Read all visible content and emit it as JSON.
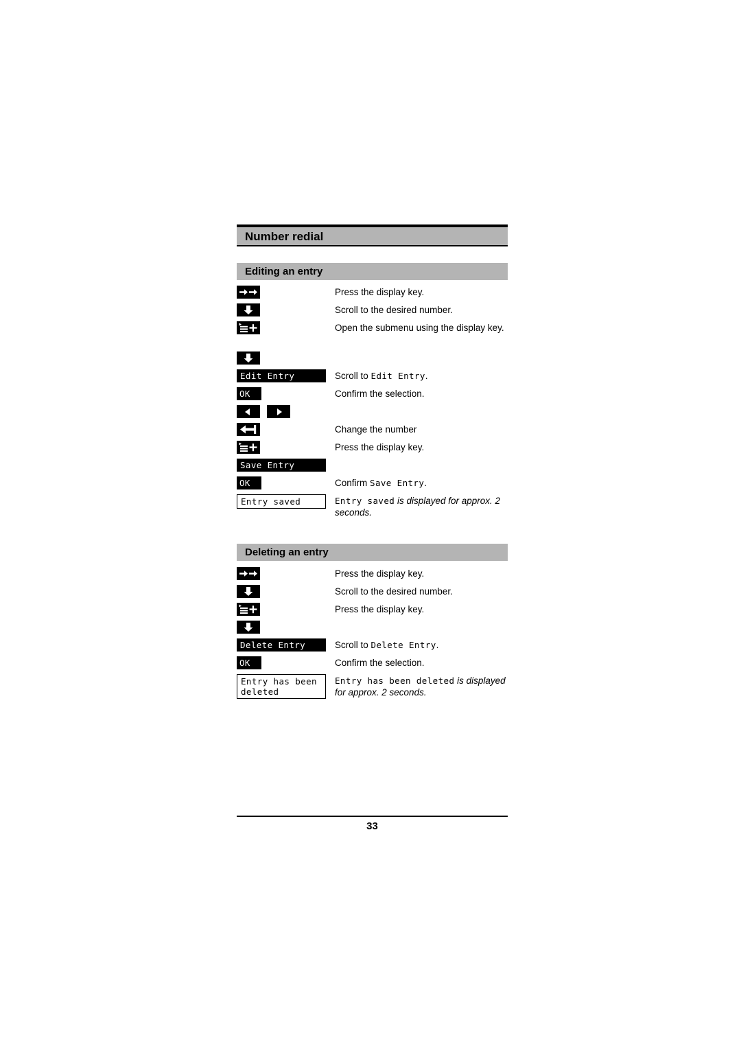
{
  "document": {
    "title": "Number redial",
    "page_number": "33"
  },
  "sections": [
    {
      "heading": "Editing an entry",
      "steps": [
        {
          "icon": "display-key-double-right-arrow-icon",
          "text_plain": "Press the display key."
        },
        {
          "icon": "down-arrow-key-icon",
          "text_plain": "Scroll to the desired number."
        },
        {
          "icon": "submenu-key-icon",
          "text_plain": "Open the submenu using the display key."
        },
        {
          "icon": "down-arrow-key-icon",
          "text_plain": ""
        },
        {
          "lcd_inverse": "Edit Entry",
          "text_before": "Scroll to ",
          "text_mono": "Edit Entry",
          "text_after": "."
        },
        {
          "lcd_ok": "OK",
          "text_plain": "Confirm the selection."
        },
        {
          "icon": "left-right-arrow-keys-icon",
          "text_plain": ""
        },
        {
          "icon": "backspace-key-icon",
          "text_plain": "Change the number"
        },
        {
          "icon": "submenu-key-icon",
          "text_plain": "Press the display key."
        },
        {
          "lcd_inverse": "Save Entry",
          "text_plain": ""
        },
        {
          "lcd_ok": "OK",
          "text_before": "Confirm ",
          "text_mono": "Save Entry",
          "text_after": "."
        },
        {
          "lcd_outline": "Entry saved",
          "text_mono_lead": "Entry saved",
          "text_italic": " is displayed for approx. 2 seconds."
        }
      ]
    },
    {
      "heading": "Deleting an entry",
      "steps": [
        {
          "icon": "display-key-double-right-arrow-icon",
          "text_plain": "Press the display key."
        },
        {
          "icon": "down-arrow-key-icon",
          "text_plain": "Scroll to the desired number."
        },
        {
          "icon": "submenu-key-icon",
          "text_plain": "Press the display key."
        },
        {
          "icon": "down-arrow-key-icon",
          "text_plain": ""
        },
        {
          "lcd_inverse": "Delete Entry",
          "text_before": "Scroll to ",
          "text_mono": "Delete Entry",
          "text_after": "."
        },
        {
          "lcd_ok": "OK",
          "text_plain": "Confirm the selection."
        },
        {
          "lcd_outline": "Entry has been\ndeleted",
          "text_mono_lead": "Entry has been deleted",
          "text_italic": " is displayed for approx. 2 seconds."
        }
      ]
    }
  ],
  "colors": {
    "bar_gray": "#b4b4b4",
    "ink": "#000000",
    "paper": "#ffffff"
  }
}
